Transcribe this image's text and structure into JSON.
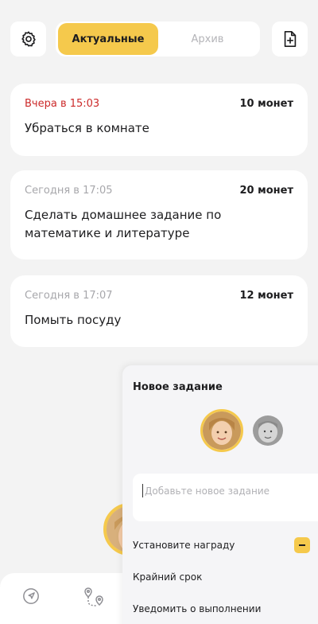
{
  "tabs": {
    "active_label": "Актуальные",
    "archive_label": "Архив"
  },
  "tasks": [
    {
      "date": "Вчера в 15:03",
      "reward": "10 монет",
      "title": "Убраться в комнате",
      "overdue": true
    },
    {
      "date": "Сегодня в 17:05",
      "reward": "20 монет",
      "title": "Сделать домашнее задание по математике и литературе",
      "overdue": false
    },
    {
      "date": "Сегодня в 17:07",
      "reward": "12 монет",
      "title": "Помыть посуду",
      "overdue": false
    }
  ],
  "new_task": {
    "title": "Новое задание",
    "input_placeholder": "Добавьте новое задание",
    "set_reward_label": "Установите награду",
    "deadline_label": "Крайний срок",
    "notify_label": "Уведомить о выполнении"
  },
  "colors": {
    "accent": "#f5c94c",
    "overdue": "#cc2a2a",
    "muted": "#a7a7ab",
    "background": "#f3f3f3"
  },
  "icons": {
    "settings": "gear-icon",
    "add_file": "file-plus-icon",
    "nav_location": "location-arrow-icon",
    "nav_route": "route-pins-icon"
  }
}
